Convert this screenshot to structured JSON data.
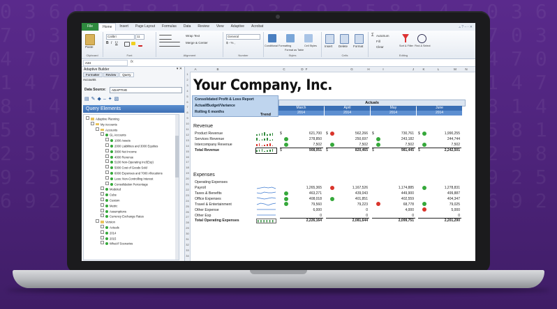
{
  "excel": {
    "tabs": [
      "File",
      "Home",
      "Insert",
      "Page Layout",
      "Formulas",
      "Data",
      "Review",
      "View",
      "Adaptive",
      "Acrobat"
    ],
    "active_tab": "Home",
    "ribbon": {
      "paste": "Paste",
      "font_name": "Calibri",
      "font_size": "11",
      "wrap_text": "Wrap Text",
      "merge": "Merge & Center",
      "number_format": "General",
      "number_fmt_buttons": "$ - % ,",
      "styles_items": [
        "Conditional Formatting",
        "Format as Table",
        "Cell Styles"
      ],
      "cells_items": [
        "Insert",
        "Delete",
        "Format"
      ],
      "autosum": "AutoSum",
      "fill": "Fill",
      "clear": "Clear",
      "sort": "Sort & Filter",
      "find": "Find & Select",
      "group_labels": [
        "Clipboard",
        "Font",
        "Alignment",
        "Number",
        "Styles",
        "Cells",
        "Editing"
      ]
    },
    "namebox": "A34",
    "fx": "fx"
  },
  "pane": {
    "title": "Adaptive Builder",
    "tabs": [
      "Formatter",
      "Review",
      "Query"
    ],
    "sub": "Accounts",
    "data_source_label": "Data Source:",
    "data_source_value": "ADAPTIVE",
    "query_elements": "Query Elements",
    "tree": [
      {
        "label": "Adaptive Planning",
        "type": "fold",
        "indent": 0
      },
      {
        "label": "My Accounts",
        "type": "fold",
        "indent": 1
      },
      {
        "label": "Accounts",
        "type": "fold",
        "indent": 2
      },
      {
        "label": "GL Accounts",
        "type": "dot",
        "indent": 3
      },
      {
        "label": "1000 Assets",
        "type": "dot",
        "indent": 4
      },
      {
        "label": "2000 Liabilities and 3000 Equities",
        "type": "dot",
        "indent": 4
      },
      {
        "label": "3800 Net Income",
        "type": "dot",
        "indent": 4
      },
      {
        "label": "4000 Revenue",
        "type": "dot",
        "indent": 4
      },
      {
        "label": "5100 Non-Operating Inc/(Exp)",
        "type": "dot",
        "indent": 4
      },
      {
        "label": "5000 Cost of Goods Sold",
        "type": "dot",
        "indent": 4
      },
      {
        "label": "6000 Expenses and 7000 Allocations",
        "type": "dot",
        "indent": 4
      },
      {
        "label": "Less: Non-Controlling Interest",
        "type": "dot",
        "indent": 4
      },
      {
        "label": "Consolidation Percentage",
        "type": "dot",
        "indent": 4
      },
      {
        "label": "Modeled",
        "type": "dot",
        "indent": 3
      },
      {
        "label": "Cube",
        "type": "dot",
        "indent": 3
      },
      {
        "label": "Custom",
        "type": "dot",
        "indent": 3
      },
      {
        "label": "Metric",
        "type": "dot",
        "indent": 3
      },
      {
        "label": "Assumptions",
        "type": "dot",
        "indent": 3
      },
      {
        "label": "Currency Exchange Rates",
        "type": "dot",
        "indent": 3
      },
      {
        "label": "Version",
        "type": "fold",
        "indent": 2
      },
      {
        "label": "Actuals",
        "type": "dot",
        "indent": 3
      },
      {
        "label": "2014",
        "type": "dot",
        "indent": 3
      },
      {
        "label": "2015",
        "type": "dot",
        "indent": 3
      },
      {
        "label": "What-If Scenarios",
        "type": "dot",
        "indent": 3
      }
    ]
  },
  "sheet": {
    "columns": [
      "A",
      "B",
      "C",
      "D",
      "F",
      "G",
      "H",
      "I",
      "J",
      "K",
      "L",
      "M",
      "N"
    ],
    "company": "Your Company, Inc.",
    "report_lines": [
      "Consolidated Profit & Loss Report",
      "Actual/Budget/Variance",
      "Rolling 6 months"
    ],
    "trend_header": "Trend",
    "actuals_header": "Actuals",
    "months": [
      {
        "month": "March",
        "year": "2014"
      },
      {
        "month": "April",
        "year": "2014"
      },
      {
        "month": "May",
        "year": "2014"
      },
      {
        "month": "June",
        "year": "2014"
      }
    ],
    "revenue_title": "Revenue",
    "revenue_rows": [
      {
        "label": "Product Revenue",
        "vals": [
          "621,700",
          "562,266",
          "730,761",
          "1,990,255"
        ],
        "status": [
          "",
          "r",
          "",
          "g"
        ],
        "dollar": true
      },
      {
        "label": "Services Revenue",
        "vals": [
          "278,850",
          "250,697",
          "243,182",
          "244,744"
        ],
        "status": [
          "g",
          "",
          "g",
          ""
        ],
        "dollar": false
      },
      {
        "label": "Intercompany Revenue",
        "vals": [
          "7,502",
          "7,502",
          "7,502",
          "7,502"
        ],
        "status": [
          "g",
          "g",
          "g",
          "g"
        ],
        "dollar": false
      },
      {
        "label": "Total Revenue",
        "vals": [
          "908,051",
          "820,465",
          "981,445",
          "2,242,501"
        ],
        "status": [
          "",
          "",
          "",
          ""
        ],
        "dollar": true,
        "bold": true
      }
    ],
    "expenses_title": "Expenses",
    "op_exp_label": "Operating Expenses",
    "expense_rows": [
      {
        "label": "Payroll",
        "vals": [
          "1,265,365",
          "1,167,526",
          "1,174,885",
          "1,278,831"
        ],
        "status": [
          "",
          "r",
          "",
          "g"
        ]
      },
      {
        "label": "Taxes & Benefits",
        "vals": [
          "463,271",
          "439,043",
          "449,900",
          "499,887"
        ],
        "status": [
          "g",
          "",
          "",
          ""
        ]
      },
      {
        "label": "Office Expenses",
        "vals": [
          "408,018",
          "401,851",
          "402,559",
          "404,347"
        ],
        "status": [
          "g",
          "g",
          "",
          ""
        ]
      },
      {
        "label": "Travel & Entertainment",
        "vals": [
          "79,560",
          "79,223",
          "68,778",
          "79,025"
        ],
        "status": [
          "g",
          "",
          "r",
          "g"
        ]
      },
      {
        "label": "Other Expense",
        "vals": [
          "6,000",
          "0",
          "4,000",
          "5,000"
        ],
        "status": [
          "",
          "",
          "",
          "r"
        ]
      },
      {
        "label": "Other Exp",
        "vals": [
          "0",
          "0",
          "0",
          "0"
        ],
        "status": [
          "",
          "",
          "",
          ""
        ]
      },
      {
        "label": "Total Operating Expenses",
        "vals": [
          "2,226,164",
          "2,081,644",
          "2,099,751",
          "2,201,290"
        ],
        "status": [
          "",
          "",
          "",
          ""
        ],
        "bold": true
      }
    ]
  },
  "colors": {
    "background": "#4b2277",
    "excel_green": "#2e8a3e",
    "header_blue": "#3a6fb5",
    "status_green": "#35a83a",
    "status_red": "#d9342b"
  }
}
